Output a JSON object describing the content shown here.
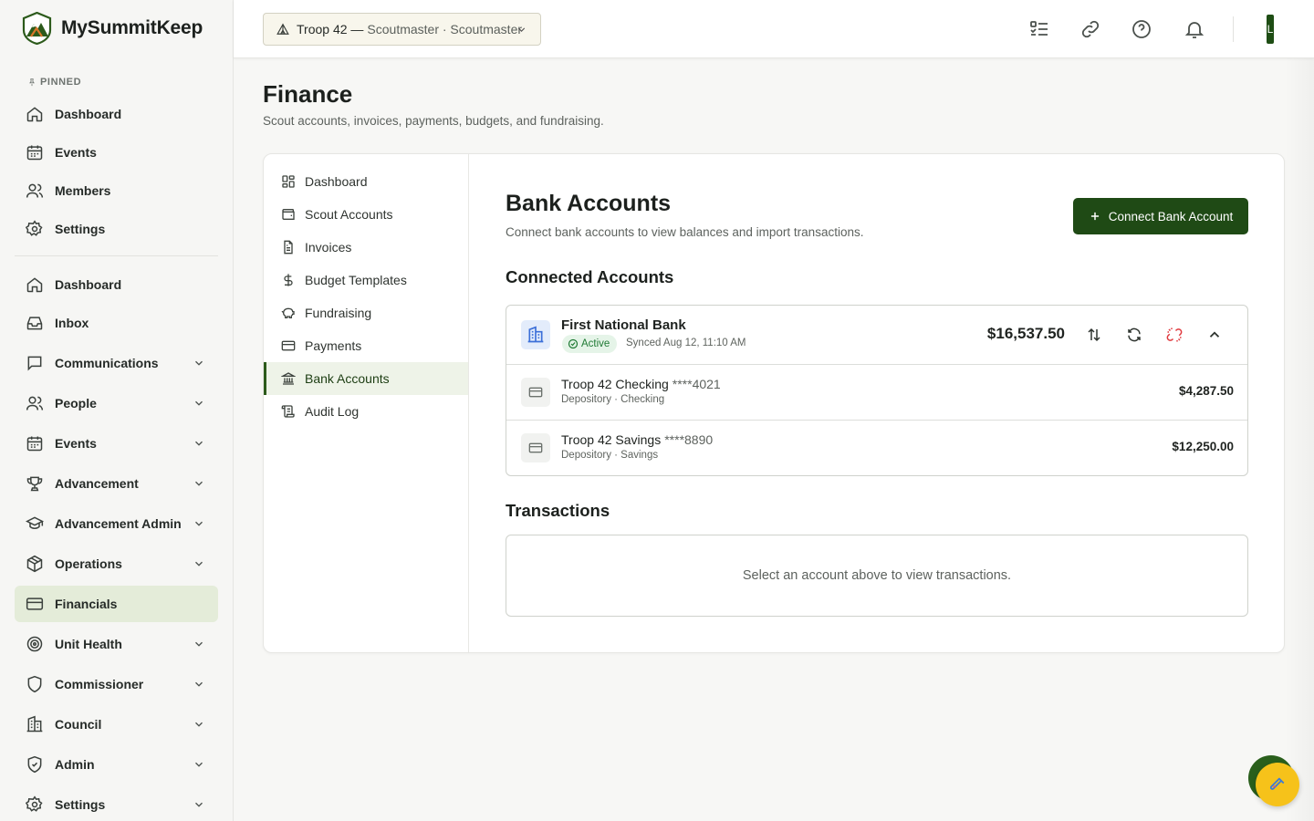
{
  "app": {
    "name": "MySummitKeep"
  },
  "sidebar": {
    "pinned_label": "PINNED",
    "pinned": [
      {
        "label": "Dashboard",
        "icon": "home-icon"
      },
      {
        "label": "Events",
        "icon": "calendar-icon"
      },
      {
        "label": "Members",
        "icon": "users-icon"
      },
      {
        "label": "Settings",
        "icon": "gear-icon"
      }
    ],
    "items": [
      {
        "label": "Dashboard",
        "icon": "home-icon",
        "expandable": false
      },
      {
        "label": "Inbox",
        "icon": "inbox-icon",
        "expandable": false
      },
      {
        "label": "Communications",
        "icon": "message-icon",
        "expandable": true
      },
      {
        "label": "People",
        "icon": "users-icon",
        "expandable": true
      },
      {
        "label": "Events",
        "icon": "calendar-icon",
        "expandable": true
      },
      {
        "label": "Advancement",
        "icon": "trophy-icon",
        "expandable": true
      },
      {
        "label": "Advancement Admin",
        "icon": "graduation-cap-icon",
        "expandable": true
      },
      {
        "label": "Operations",
        "icon": "box-icon",
        "expandable": true
      },
      {
        "label": "Financials",
        "icon": "credit-card-icon",
        "expandable": false,
        "active": true
      },
      {
        "label": "Unit Health",
        "icon": "target-icon",
        "expandable": true
      },
      {
        "label": "Commissioner",
        "icon": "shield-icon",
        "expandable": true
      },
      {
        "label": "Council",
        "icon": "building-icon",
        "expandable": true
      },
      {
        "label": "Admin",
        "icon": "shield-check-icon",
        "expandable": true
      },
      {
        "label": "Settings",
        "icon": "gear-icon",
        "expandable": true
      }
    ]
  },
  "topbar": {
    "troop_name": "Troop 42 —",
    "troop_role": "Scoutmaster · Scoutmaster",
    "icons": [
      "checklist-icon",
      "link-icon",
      "help-icon",
      "bell-icon"
    ],
    "avatar_initial": "L"
  },
  "page": {
    "title": "Finance",
    "subtitle": "Scout accounts, invoices, payments, budgets, and fundraising."
  },
  "subnav": [
    {
      "label": "Dashboard",
      "icon": "dashboard-icon"
    },
    {
      "label": "Scout Accounts",
      "icon": "wallet-icon"
    },
    {
      "label": "Invoices",
      "icon": "file-text-icon"
    },
    {
      "label": "Budget Templates",
      "icon": "dollar-icon"
    },
    {
      "label": "Fundraising",
      "icon": "piggy-bank-icon"
    },
    {
      "label": "Payments",
      "icon": "credit-card-icon"
    },
    {
      "label": "Bank Accounts",
      "icon": "landmark-icon",
      "active": true
    },
    {
      "label": "Audit Log",
      "icon": "scroll-icon"
    }
  ],
  "bank": {
    "title": "Bank Accounts",
    "subtitle": "Connect bank accounts to view balances and import transactions.",
    "connect_label": "Connect Bank Account",
    "connected_heading": "Connected Accounts",
    "institution": {
      "name": "First National Bank",
      "status": "Active",
      "synced": "Synced Aug 12, 11:10 AM",
      "total": "$16,537.50",
      "status_color": "#1f7a34"
    },
    "accounts": [
      {
        "name": "Troop 42 Checking",
        "mask": "****4021",
        "type": "Depository · Checking",
        "balance": "$4,287.50"
      },
      {
        "name": "Troop 42 Savings",
        "mask": "****8890",
        "type": "Depository · Savings",
        "balance": "$12,250.00"
      }
    ],
    "transactions_heading": "Transactions",
    "transactions_empty": "Select an account above to view transactions."
  },
  "colors": {
    "brand": "#1f4a15",
    "active_nav": "#e4ecd9",
    "fab": "#f6c21a"
  }
}
